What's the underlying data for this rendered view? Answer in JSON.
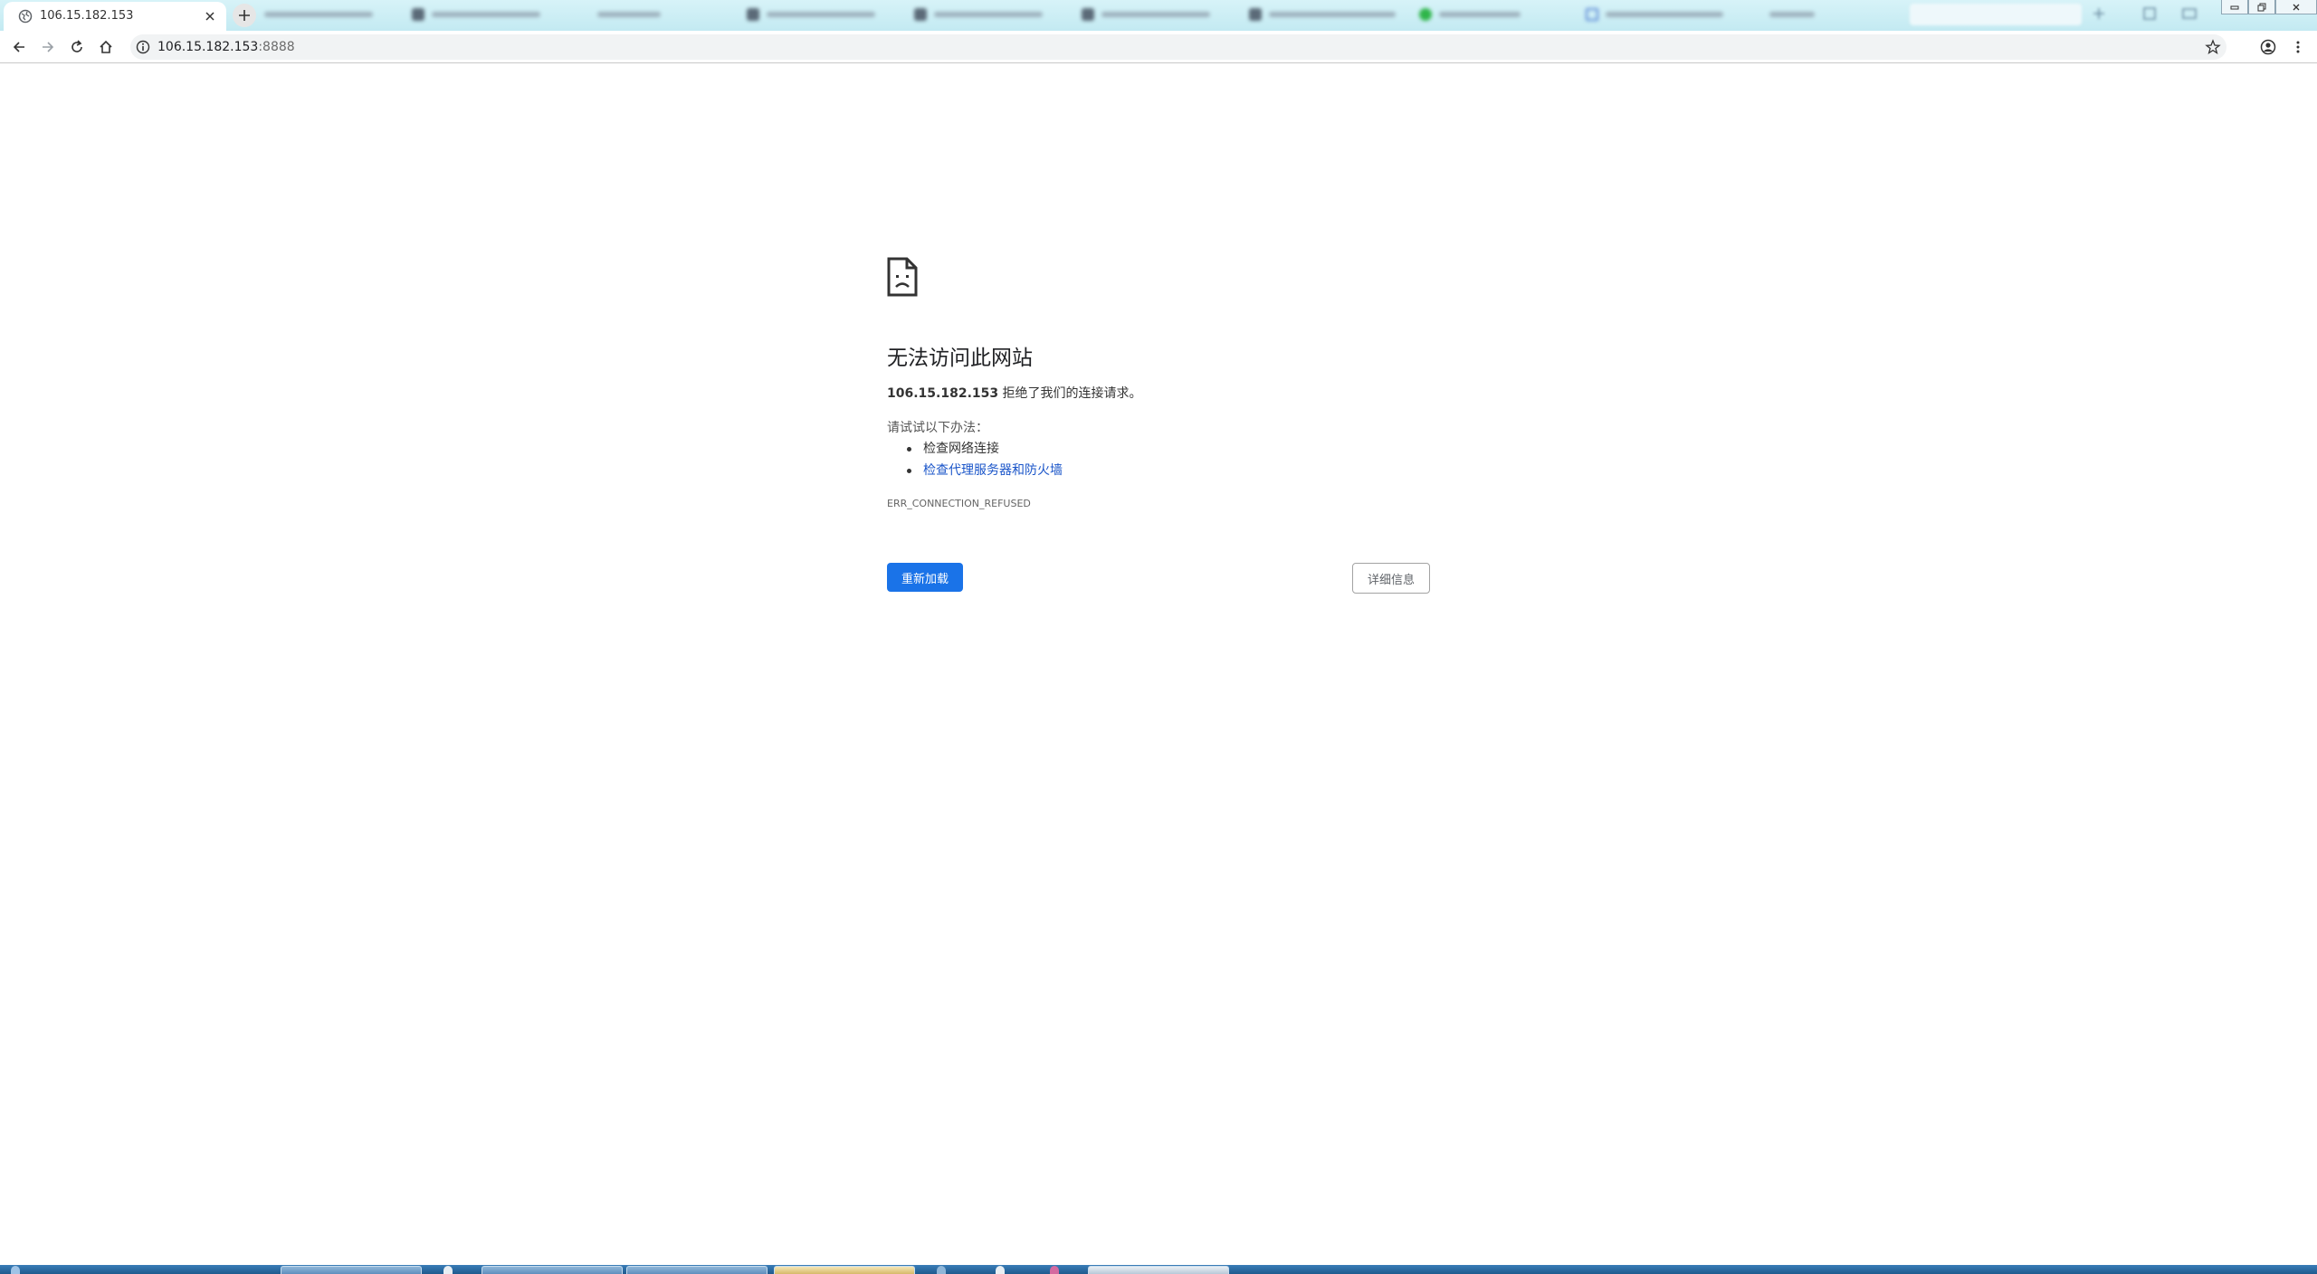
{
  "browser": {
    "active_tab": {
      "title": "106.15.182.153"
    },
    "address_bar": {
      "host": "106.15.182.153",
      "port": ":8888"
    }
  },
  "error_page": {
    "title": "无法访问此网站",
    "host": "106.15.182.153",
    "summary_text": " 拒绝了我们的连接请求。",
    "suggestions_label": "请试试以下办法：",
    "suggestions": [
      "检查网络连接",
      "检查代理服务器和防火墙"
    ],
    "error_code": "ERR_CONNECTION_REFUSED",
    "reload_label": "重新加载",
    "details_label": "详细信息"
  },
  "colors": {
    "primary_button": "#1a73e8",
    "link": "#1a55c9",
    "tab_strip": "#c3eaf2",
    "taskbar": "#1f5a8e"
  },
  "icons": [
    "sad-page-icon",
    "globe-icon",
    "close-icon",
    "plus-icon",
    "back-arrow-icon",
    "forward-arrow-icon",
    "reload-icon",
    "home-icon",
    "info-icon",
    "star-icon",
    "account-icon",
    "kebab-menu-icon"
  ]
}
